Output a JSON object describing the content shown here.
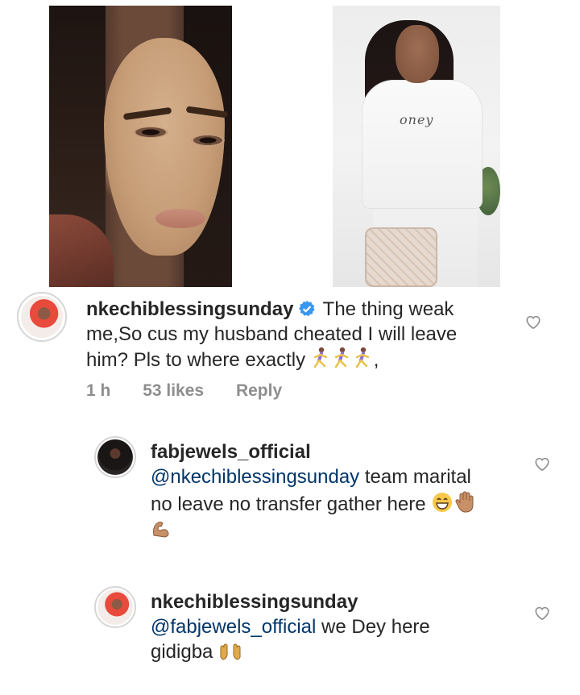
{
  "post_images": [
    {
      "name": "photo-left"
    },
    {
      "name": "photo-right",
      "shirt_text": "oney"
    }
  ],
  "comment": {
    "username": "nkechiblessingsunday",
    "line1_text": "The thing weak",
    "line2_text": "me,So cus my husband cheated I will leave",
    "line3_text": "him? Pls to where exactly",
    "line3_suffix": ",",
    "time": "1 h",
    "likes": "53 likes",
    "reply_label": "Reply"
  },
  "replies": [
    {
      "username": "fabjewels_official",
      "mention": "@nkechiblessingsunday",
      "line1_text": " team marital",
      "line2_text": "no leave no transfer gather here"
    },
    {
      "username": "nkechiblessingsunday",
      "mention": "@fabjewels_official",
      "line1_text": " we Dey here",
      "line2_text": "gidigba"
    }
  ],
  "icons": [
    "verified-badge-icon",
    "heart-icon",
    "running-woman-emoji",
    "grinning-emoji",
    "raised-hand-emoji",
    "flexed-biceps-emoji",
    "raising-hands-emoji"
  ],
  "colors": {
    "mention": "#003569",
    "meta": "#8e8e8e",
    "verified": "#3897f0",
    "text": "#262626"
  }
}
